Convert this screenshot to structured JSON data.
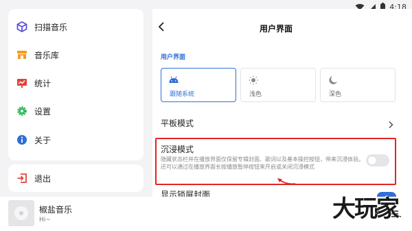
{
  "status_bar": {
    "time": "4:18"
  },
  "sidebar": {
    "items": [
      {
        "label": "扫描音乐",
        "icon": "cube-icon",
        "color": "#5b4fd6"
      },
      {
        "label": "音乐库",
        "icon": "store-icon",
        "color": "#f59a23"
      },
      {
        "label": "统计",
        "icon": "chart-board-icon",
        "color": "#e0443c"
      },
      {
        "label": "设置",
        "icon": "gear-icon",
        "color": "#2fb85a"
      },
      {
        "label": "关于",
        "icon": "info-icon",
        "color": "#2f6fd6"
      }
    ],
    "exit": {
      "label": "退出",
      "icon": "exit-icon",
      "color": "#e0443c"
    }
  },
  "player": {
    "title": "椒盐音乐",
    "subtitle": "Hi~"
  },
  "panel": {
    "title": "用户界面",
    "section_label": "用户界面",
    "themes": [
      {
        "label": "跟随系统",
        "icon": "android-icon",
        "selected": true
      },
      {
        "label": "浅色",
        "icon": "sun-icon",
        "selected": false
      },
      {
        "label": "深色",
        "icon": "moon-icon",
        "selected": false
      }
    ],
    "tablet_mode": "平板模式",
    "immersive": {
      "title": "沉浸模式",
      "description": "隐藏状态栏并在播放界面仅保留专辑封面、歌词以及基本操控按钮，带来沉浸体验。还可以通过在播放界面长按播放暂停按钮来开启或关闭沉浸模式",
      "enabled": false
    },
    "lock_cover": {
      "title": "显示锁屏封面",
      "enabled": true
    }
  },
  "watermark": "大玩家",
  "colors": {
    "accent": "#2f6fd6",
    "highlight": "#e02424"
  }
}
